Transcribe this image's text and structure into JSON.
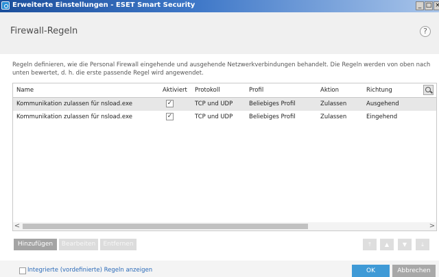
{
  "window": {
    "title": "Erweiterte Einstellungen - ESET Smart Security",
    "controls": {
      "minimize": "_",
      "maximize": "□",
      "close": "×"
    }
  },
  "header": {
    "title": "Firewall-Regeln",
    "help_label": "?"
  },
  "description": "Regeln definieren, wie die Personal Firewall eingehende und ausgehende Netzwerkverbindungen behandelt. Die Regeln werden von oben nach unten bewertet, d. h. die erste passende Regel wird angewendet.",
  "table": {
    "columns": [
      "Name",
      "Aktiviert",
      "Protokoll",
      "Profil",
      "Aktion",
      "Richtung"
    ],
    "rows": [
      {
        "name": "Kommunikation zulassen für nsload.exe",
        "enabled": "✓",
        "protocol": "TCP und UDP",
        "profile": "Beliebiges Profil",
        "action": "Zulassen",
        "direction": "Ausgehend"
      },
      {
        "name": "Kommunikation zulassen für nsload.exe",
        "enabled": "✓",
        "protocol": "TCP und UDP",
        "profile": "Beliebiges Profil",
        "action": "Zulassen",
        "direction": "Eingehend"
      }
    ],
    "scroll_left": "<",
    "scroll_right": ">"
  },
  "actions": {
    "add": "Hinzufügen",
    "edit": "Bearbeiten",
    "remove": "Entfernen",
    "move_top": "⤒",
    "move_up": "▲",
    "move_down": "▼",
    "move_bottom": "⤓"
  },
  "footer": {
    "show_builtin_label": "Integrierte (vordefinierte) Regeln anzeigen",
    "ok": "OK",
    "cancel": "Abbrechen"
  },
  "colors": {
    "titlebar": "#1c4f9c",
    "ok_button": "#3f9ad6",
    "link": "#2a6ab8"
  }
}
